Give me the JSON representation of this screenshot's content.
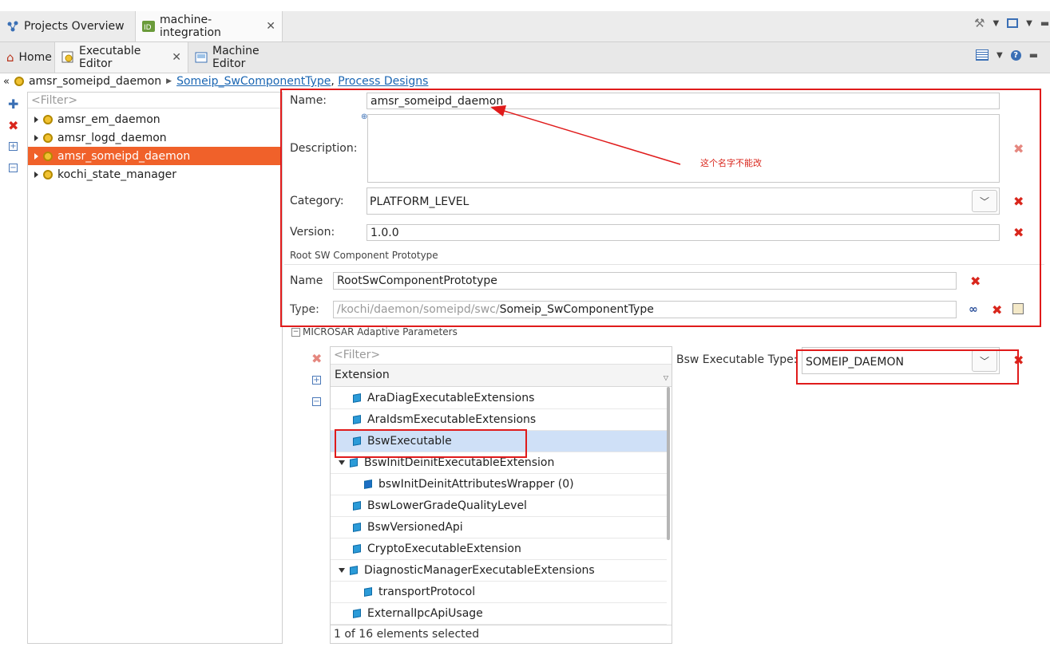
{
  "top_tabs": {
    "projects_overview": "Projects Overview",
    "machine_integration": "machine-integration"
  },
  "editor_tabs": {
    "home": "Home",
    "executable_editor": "Executable Editor",
    "machine_editor": "Machine Editor"
  },
  "breadcrumb": {
    "current": "amsr_someipd_daemon",
    "link1": "Someip_SwComponentType",
    "separator": ",",
    "link2": "Process Designs"
  },
  "tree": {
    "filter_placeholder": "<Filter>",
    "items": [
      {
        "label": "amsr_em_daemon"
      },
      {
        "label": "amsr_logd_daemon"
      },
      {
        "label": "amsr_someipd_daemon"
      },
      {
        "label": "kochi_state_manager"
      }
    ]
  },
  "form": {
    "name_label": "Name:",
    "name_value": "amsr_someipd_daemon",
    "description_label": "Description:",
    "description_value": "",
    "annotation": "这个名字不能改",
    "category_label": "Category:",
    "category_value": "PLATFORM_LEVEL",
    "version_label": "Version:",
    "version_value": "1.0.0",
    "root_section": "Root SW Component Prototype",
    "root_name_label": "Name",
    "root_name_value": "RootSwComponentPrototype",
    "type_label": "Type:",
    "type_path": "/kochi/daemon/someipd/swc/",
    "type_value": "Someip_SwComponentType"
  },
  "microsar": {
    "section_title": "MICROSAR Adaptive Parameters",
    "filter_placeholder": "<Filter>",
    "column_header": "Extension",
    "rows": [
      {
        "label": "AraDiagExecutableExtensions"
      },
      {
        "label": "AraIdsmExecutableExtensions"
      },
      {
        "label": "BswExecutable"
      },
      {
        "label": "BswInitDeinitExecutableExtension"
      },
      {
        "label": "bswInitDeinitAttributesWrapper (0)"
      },
      {
        "label": "BswLowerGradeQualityLevel"
      },
      {
        "label": "BswVersionedApi"
      },
      {
        "label": "CryptoExecutableExtension"
      },
      {
        "label": "DiagnosticManagerExecutableExtensions"
      },
      {
        "label": "transportProtocol"
      },
      {
        "label": "ExternalIpcApiUsage"
      }
    ],
    "status": "1 of 16 elements selected",
    "bsw_type_label": "Bsw Executable Type:",
    "bsw_type_value": "SOMEIP_DAEMON"
  },
  "colors": {
    "selection_orange": "#f0612a",
    "annotation_red": "#e01b1b",
    "link_blue": "#1a66b3"
  }
}
